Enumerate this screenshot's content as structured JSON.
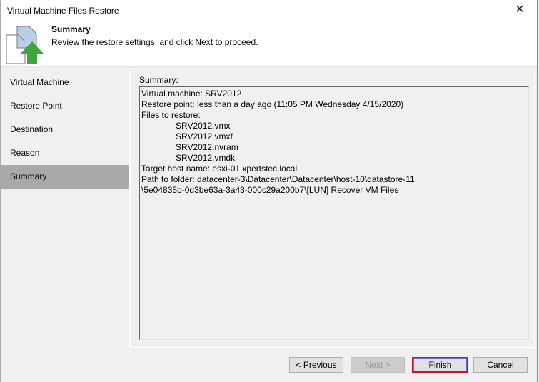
{
  "window": {
    "title": "Virtual Machine Files Restore",
    "close_icon": "close-icon"
  },
  "header": {
    "icon": "file-restore-icon",
    "step_title": "Summary",
    "step_description": "Review the restore settings, and click Next to proceed."
  },
  "sidebar": {
    "items": [
      {
        "label": "Virtual Machine",
        "selected": false
      },
      {
        "label": "Restore Point",
        "selected": false
      },
      {
        "label": "Destination",
        "selected": false
      },
      {
        "label": "Reason",
        "selected": false
      },
      {
        "label": "Summary",
        "selected": true
      }
    ]
  },
  "summary": {
    "label": "Summary:",
    "lines": [
      {
        "text": "Virtual machine: SRV2012",
        "indent": false
      },
      {
        "text": "Restore point: less than a day ago (11:05 PM Wednesday 4/15/2020)",
        "indent": false
      },
      {
        "text": "Files to restore:",
        "indent": false
      },
      {
        "text": "SRV2012.vmx",
        "indent": true
      },
      {
        "text": "SRV2012.vmxf",
        "indent": true
      },
      {
        "text": "SRV2012.nvram",
        "indent": true
      },
      {
        "text": "SRV2012.vmdk",
        "indent": true
      },
      {
        "text": "Target host name: esxi-01.xpertstec.local",
        "indent": false
      },
      {
        "text": "Path to folder: datacenter-3\\Datacenter\\Datacenter\\host-10\\datastore-11",
        "indent": false
      },
      {
        "text": "\\5e04835b-0d3be63a-3a43-000c29a200b7\\[LUN] Recover VM Files",
        "indent": false
      }
    ]
  },
  "buttons": {
    "previous": "< Previous",
    "next": "Next >",
    "finish": "Finish",
    "cancel": "Cancel"
  },
  "colors": {
    "finish_highlight": "#c8102e",
    "selected_nav": "#a9a9a9",
    "icon_arrow": "#3fa53f",
    "icon_doc_fill": "#b9cfe8"
  }
}
